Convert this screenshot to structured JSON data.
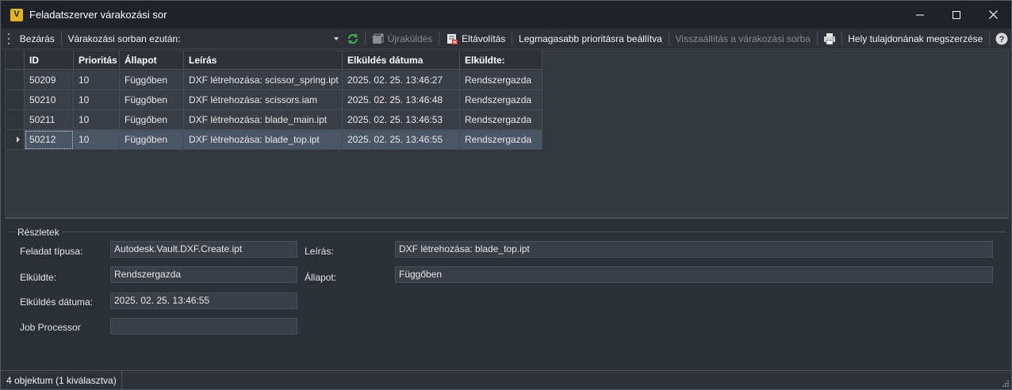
{
  "window": {
    "title": "Feladatszerver várakozási sor",
    "app_icon_letter": "V"
  },
  "toolbar": {
    "close_label": "Bezárás",
    "after_queue_label": "Várakozási sorban ezután:",
    "after_queue_value": "",
    "resubmit_label": "Újraküldés",
    "remove_label": "Eltávolítás",
    "highest_priority_label": "Legmagasabb prioritásra beállítva",
    "requeue_label": "Visszaállítás a várakozási sorba",
    "take_ownership_label": "Hely tulajdonának megszerzése"
  },
  "grid": {
    "columns": [
      "ID",
      "Prioritás",
      "Állapot",
      "Leírás",
      "Elküldés dátuma",
      "Elküldte:"
    ],
    "rows": [
      {
        "id": "50209",
        "priority": "10",
        "status": "Függőben",
        "description": "DXF létrehozása: scissor_spring.ipt",
        "date": "2025. 02. 25. 13:46:27",
        "sender": "Rendszergazda"
      },
      {
        "id": "50210",
        "priority": "10",
        "status": "Függőben",
        "description": "DXF létrehozása: scissors.iam",
        "date": "2025. 02. 25. 13:46:48",
        "sender": "Rendszergazda"
      },
      {
        "id": "50211",
        "priority": "10",
        "status": "Függőben",
        "description": "DXF létrehozása: blade_main.ipt",
        "date": "2025. 02. 25. 13:46:53",
        "sender": "Rendszergazda"
      },
      {
        "id": "50212",
        "priority": "10",
        "status": "Függőben",
        "description": "DXF létrehozása: blade_top.ipt",
        "date": "2025. 02. 25. 13:46:55",
        "sender": "Rendszergazda"
      }
    ]
  },
  "details": {
    "title": "Részletek",
    "task_type_label": "Feladat típusa:",
    "task_type_value": "Autodesk.Vault.DXF.Create.ipt",
    "description_label": "Leírás:",
    "description_value": "DXF létrehozása: blade_top.ipt",
    "sender_label": "Elküldte:",
    "sender_value": "Rendszergazda",
    "status_label": "Állapot:",
    "status_value": "Függőben",
    "date_label": "Elküldés dátuma:",
    "date_value": "2025. 02. 25. 13:46:55",
    "job_processor_label": "Job Processor",
    "job_processor_value": ""
  },
  "status_bar": {
    "text": "4 objektum (1 kiválasztva)"
  },
  "colors": {
    "app_icon": "#e2b512",
    "refresh_icon": "#3fb04a",
    "selected_row": "#4a5565"
  }
}
